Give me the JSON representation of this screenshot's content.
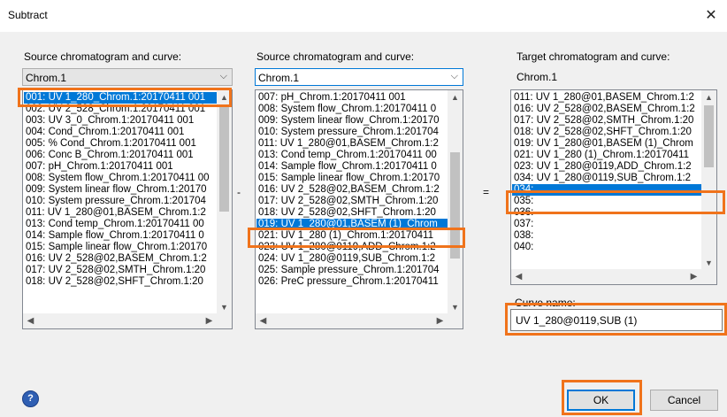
{
  "window": {
    "title": "Subtract"
  },
  "columns": [
    {
      "label": "Source chromatogram and curve:",
      "combo": "Chrom.1"
    },
    {
      "label": "Source chromatogram and curve:",
      "combo": "Chrom.1"
    },
    {
      "label": "Target chromatogram and curve:",
      "target": "Chrom.1"
    }
  ],
  "operators": {
    "minus": "-",
    "equals": "="
  },
  "list1": [
    "001: UV 1_280_Chrom.1:20170411 001",
    "002: UV 2_528_Chrom.1:20170411 001",
    "003: UV 3_0_Chrom.1:20170411 001",
    "004: Cond_Chrom.1:20170411 001",
    "005: % Cond_Chrom.1:20170411 001",
    "006: Conc B_Chrom.1:20170411 001",
    "007: pH_Chrom.1:20170411 001",
    "008: System flow_Chrom.1:20170411 00",
    "009: System linear flow_Chrom.1:20170",
    "010: System pressure_Chrom.1:201704",
    "011: UV 1_280@01,BASEM_Chrom.1:2",
    "013: Cond temp_Chrom.1:20170411 00",
    "014: Sample flow_Chrom.1:20170411 0",
    "015: Sample linear flow_Chrom.1:20170",
    "016: UV 2_528@02,BASEM_Chrom.1:2",
    "017: UV 2_528@02,SMTH_Chrom.1:20",
    "018: UV 2_528@02,SHFT_Chrom.1:20"
  ],
  "list2": [
    "007: pH_Chrom.1:20170411 001",
    "008: System flow_Chrom.1:20170411 0",
    "009: System linear flow_Chrom.1:20170",
    "010: System pressure_Chrom.1:201704",
    "011: UV 1_280@01,BASEM_Chrom.1:2",
    "013: Cond temp_Chrom.1:20170411 00",
    "014: Sample flow_Chrom.1:20170411 0",
    "015: Sample linear flow_Chrom.1:20170",
    "016: UV 2_528@02,BASEM_Chrom.1:2",
    "017: UV 2_528@02,SMTH_Chrom.1:20",
    "018: UV 2_528@02,SHFT_Chrom.1:20",
    "019: UV 1_280@01,BASEM (1)_Chrom",
    "021: UV 1_280 (1)_Chrom.1:20170411",
    "023: UV 1_280@0119,ADD_Chrom.1:2",
    "024: UV 1_280@0119,SUB_Chrom.1:2",
    "025: Sample pressure_Chrom.1:201704",
    "026: PreC pressure_Chrom.1:20170411"
  ],
  "list3": [
    "011: UV 1_280@01,BASEM_Chrom.1:2",
    "016: UV 2_528@02,BASEM_Chrom.1:2",
    "017: UV 2_528@02,SMTH_Chrom.1:20",
    "018: UV 2_528@02,SHFT_Chrom.1:20",
    "019: UV 1_280@01,BASEM (1)_Chrom",
    "021: UV 1_280 (1)_Chrom.1:20170411",
    "023: UV 1_280@0119,ADD_Chrom.1:2",
    "034: UV 1_280@0119,SUB_Chrom.1:2",
    "034:",
    "035:",
    "036:",
    "037:",
    "038:",
    "040:"
  ],
  "curve_name": {
    "label": "Curve name:",
    "value": "UV 1_280@0119,SUB (1)"
  },
  "buttons": {
    "ok": "OK",
    "cancel": "Cancel",
    "help": "?"
  },
  "colors": {
    "selection": "#0078d7",
    "highlight": "#f0731b",
    "help": "#2f5fb3"
  }
}
